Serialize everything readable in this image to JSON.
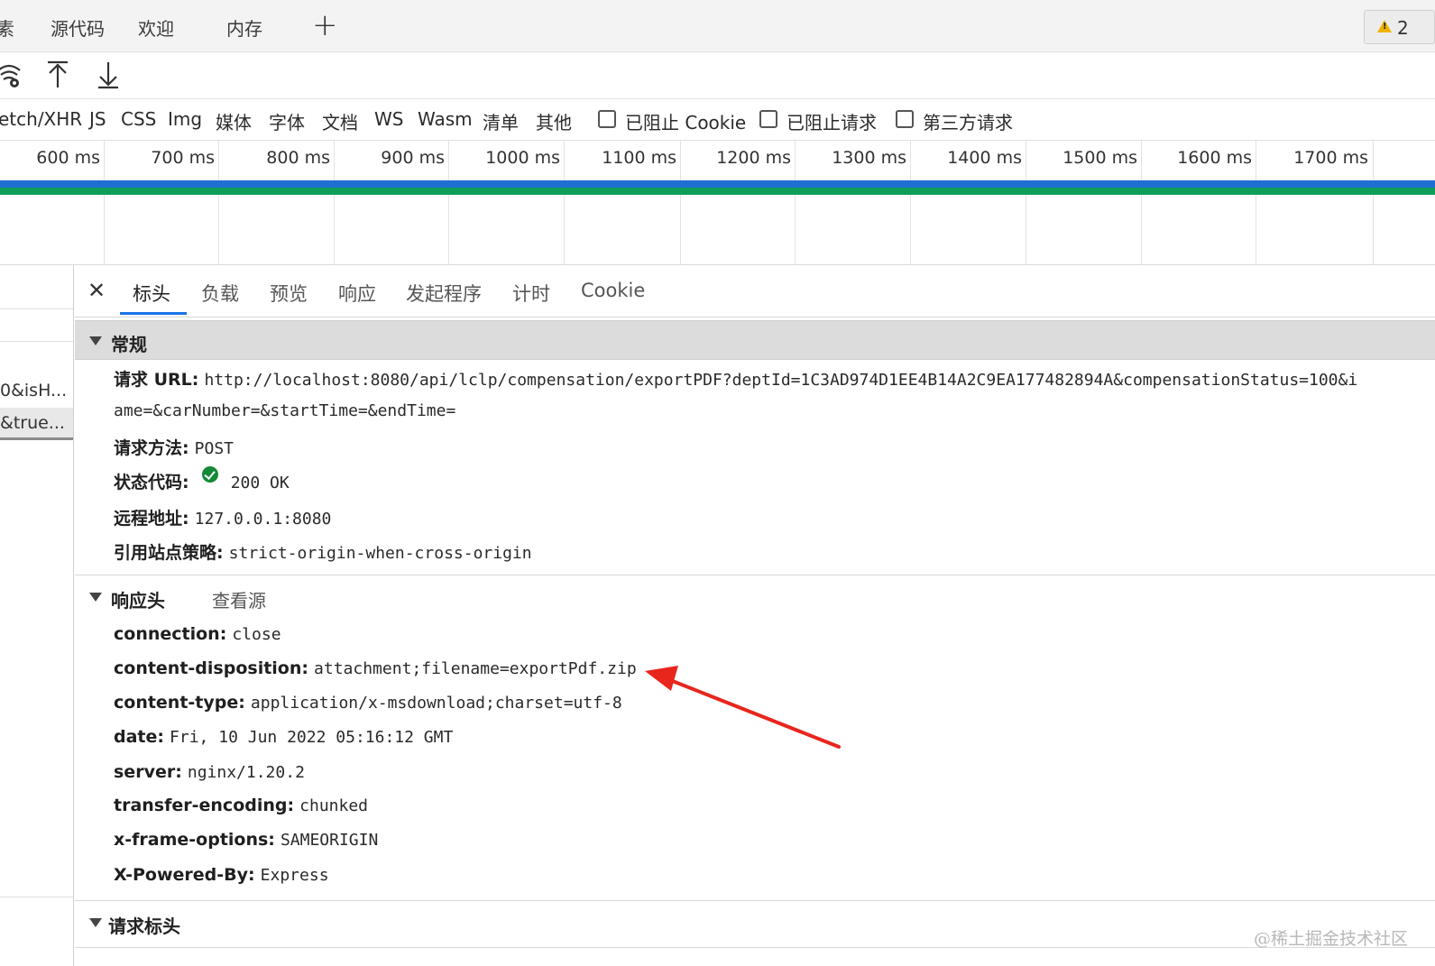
{
  "top_tabs": [
    "素",
    "源代码",
    "欢迎",
    "内存"
  ],
  "warning_count": "2",
  "filters": [
    "etch/XHR",
    "JS",
    "CSS",
    "Img",
    "媒体",
    "字体",
    "文档",
    "WS",
    "Wasm",
    "清单",
    "其他"
  ],
  "checkboxes": [
    "已阻止 Cookie",
    "已阻止请求",
    "第三方请求"
  ],
  "timeline_ticks": [
    "600 ms",
    "700 ms",
    "800 ms",
    "900 ms",
    "1000 ms",
    "1100 ms",
    "1200 ms",
    "1300 ms",
    "1400 ms",
    "1500 ms",
    "1600 ms",
    "1700 ms"
  ],
  "request_list": [
    "0&isH...",
    "&true..."
  ],
  "detail_tabs": [
    "标头",
    "负载",
    "预览",
    "响应",
    "发起程序",
    "计时",
    "Cookie"
  ],
  "general": {
    "title": "常规",
    "url_key": "请求 URL:",
    "url_value_line1": "http://localhost:8080/api/lclp/compensation/exportPDF?deptId=1C3AD974D1EE4B14A2C9EA177482894A&compensationStatus=100&i",
    "url_value_line2": "ame=&carNumber=&startTime=&endTime=",
    "method_key": "请求方法:",
    "method_value": "POST",
    "status_key": "状态代码:",
    "status_value": "200 OK",
    "remote_key": "远程地址:",
    "remote_value": "127.0.0.1:8080",
    "policy_key": "引用站点策略:",
    "policy_value": "strict-origin-when-cross-origin"
  },
  "response_headers": {
    "title": "响应头",
    "view_source": "查看源",
    "items": [
      {
        "k": "connection:",
        "v": "close"
      },
      {
        "k": "content-disposition:",
        "v": "attachment;filename=exportPdf.zip"
      },
      {
        "k": "content-type:",
        "v": "application/x-msdownload;charset=utf-8"
      },
      {
        "k": "date:",
        "v": "Fri, 10 Jun 2022 05:16:12 GMT"
      },
      {
        "k": "server:",
        "v": "nginx/1.20.2"
      },
      {
        "k": "transfer-encoding:",
        "v": "chunked"
      },
      {
        "k": "x-frame-options:",
        "v": "SAMEORIGIN"
      },
      {
        "k": "X-Powered-By:",
        "v": "Express"
      }
    ]
  },
  "request_headers": {
    "title": "请求标头"
  },
  "watermark": "@稀土掘金技术社区",
  "colors": {
    "accent": "#1a73e8",
    "timeline_blue": "#1f6fd1",
    "timeline_green": "#0f9d58",
    "annotation_arrow": "#e8261c"
  }
}
